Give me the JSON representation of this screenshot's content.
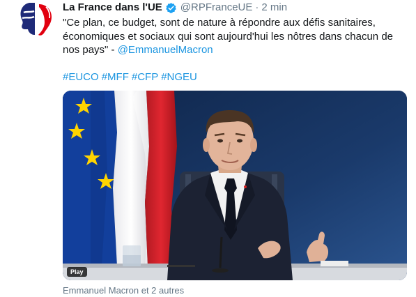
{
  "tweet": {
    "author_name": "La France dans l'UE",
    "author_handle": "@RPFranceUE",
    "separator": "·",
    "time": "2 min",
    "text_quote": "\"Ce plan, ce budget, sont de nature à répondre aux défis sanitaires, économiques et sociaux qui sont aujourd'hui les nôtres dans chacun de nos pays\" - ",
    "mention": "@EmmanuelMacron",
    "hashtags": [
      "#EUCO",
      "#MFF",
      "#CFP",
      "#NGEU"
    ],
    "video_badge": "Play",
    "footer": "Emmanuel Macron et 2 autres"
  },
  "colors": {
    "link": "#1b95e0",
    "text": "#14171a",
    "muted": "#657786",
    "verified": "#1da1f2"
  },
  "icons": {
    "avatar": "marianne-logo",
    "verified": "verified-badge-icon"
  }
}
